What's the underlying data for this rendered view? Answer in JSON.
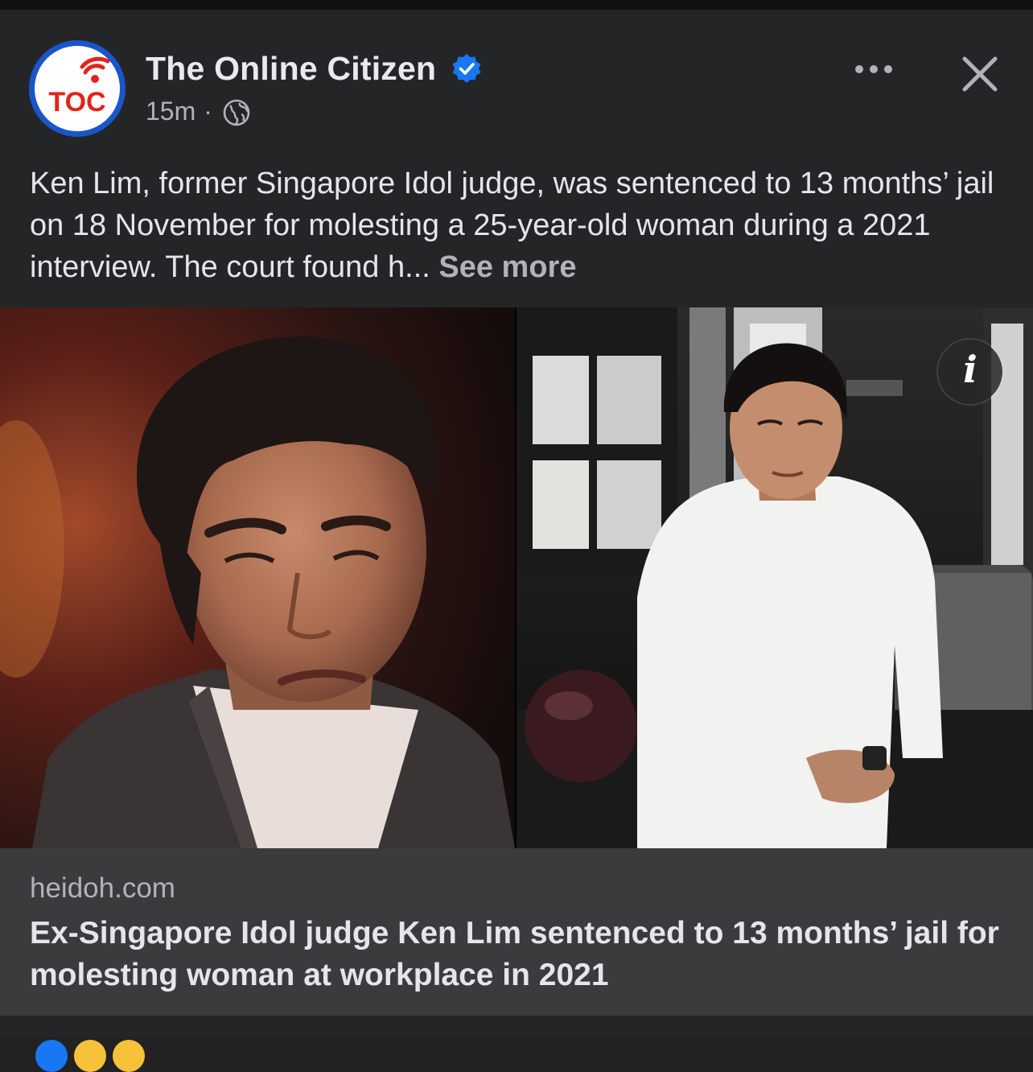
{
  "post": {
    "page_name": "The Online Citizen",
    "avatar_text": "TOC",
    "verified_icon": "verified-badge-icon",
    "time": "15m",
    "separator": "·",
    "audience_icon": "globe-icon",
    "more_icon": "more-horizontal-icon",
    "close_icon": "close-icon",
    "caption": "Ken Lim, former Singapore Idol judge, was sentenced to 13 months’ jail on 18 November for molesting a 25-year-old woman during a 2021 interview. The court found h...",
    "see_more": "See more",
    "info_icon_label": "i",
    "link": {
      "domain": "heidoh.com",
      "headline": "Ex-Singapore Idol judge Ken Lim sentenced to 13 months’ jail for molesting woman at workplace in 2021"
    }
  },
  "colors": {
    "background": "#242526",
    "card": "#3a3b3c",
    "text_primary": "#e4e6eb",
    "text_secondary": "#b0b3b8",
    "verified_blue": "#1877f2",
    "avatar_ring": "#1a56c9",
    "avatar_red": "#e2231a"
  },
  "reactions": [
    "like",
    "haha",
    "wow"
  ]
}
